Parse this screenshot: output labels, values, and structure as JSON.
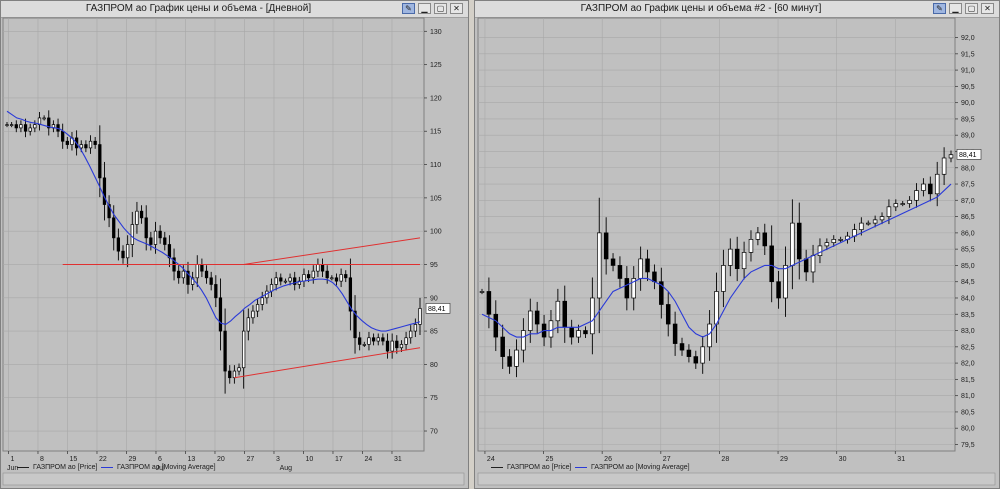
{
  "windows": [
    {
      "title": "ГАЗПРОМ ао График цены и объема - [Дневной]",
      "legend": [
        "ГАЗПРОМ ао [Price]",
        "ГАЗПРОМ ао [Moving Average]"
      ]
    },
    {
      "title": "ГАЗПРОМ ао График цены и объема #2 - [60 минут]",
      "legend": [
        "ГАЗПРОМ ао [Price]",
        "ГАЗПРОМ ао [Moving Average]"
      ]
    }
  ],
  "colors": {
    "plot_bg": "#c0c0c0",
    "grid": "#a8a8a8",
    "candle": "#000000",
    "moving_average": "#2a3ad8",
    "trend_line": "#e03030"
  },
  "icons": [
    "pin-icon",
    "minimize-icon",
    "maximize-icon",
    "close-icon"
  ],
  "chart_data": [
    {
      "type": "candlestick",
      "ylim": [
        67,
        132
      ],
      "y_ticks": [
        70,
        75,
        80,
        85,
        90,
        95,
        100,
        105,
        110,
        115,
        120,
        125,
        130
      ],
      "x_ticks": [
        "1",
        "8",
        "15",
        "22",
        "29",
        "6",
        "13",
        "20",
        "27",
        "3",
        "10",
        "17",
        "24",
        "31"
      ],
      "months": [
        "Jun",
        "Jul",
        "Aug"
      ],
      "last_price_label": "88,41",
      "close": [
        116,
        116,
        115.5,
        116,
        115,
        115.5,
        116,
        117,
        117,
        115.5,
        116,
        115,
        113.5,
        113,
        114,
        112.5,
        113,
        112.5,
        113.5,
        113,
        108,
        104,
        102,
        99,
        97,
        96,
        98,
        101,
        103,
        102,
        99,
        98,
        100,
        99,
        98,
        96,
        94,
        93,
        94,
        92,
        93,
        95,
        94,
        93,
        92,
        90,
        85,
        79,
        78,
        79,
        79.5,
        85,
        87,
        88,
        89,
        90,
        91,
        92,
        93,
        92.5,
        92.5,
        93,
        92,
        92.5,
        93.5,
        93,
        94,
        95,
        94,
        93,
        93,
        92.5,
        93.5,
        93,
        88,
        84,
        83,
        83,
        84,
        83.5,
        84,
        83.5,
        82,
        83.5,
        82.5,
        83,
        84,
        85,
        86,
        88.4
      ],
      "series": [
        {
          "name": "ГАЗПРОМ ао [Moving Average]",
          "values": [
            118,
            117.5,
            117,
            116.8,
            116.5,
            116.3,
            116.2,
            116,
            115.8,
            115.6,
            115.5,
            115.3,
            114.8,
            114.2,
            113.5,
            112.5,
            111.2,
            109.8,
            108.3,
            106.8,
            105.2,
            103.8,
            102.5,
            101.5,
            100.5,
            99.7,
            99,
            98.6,
            98.3,
            98,
            97.6,
            97.2,
            96.8,
            96.3,
            95.8,
            95.2,
            94.6,
            93.8,
            93,
            92.2,
            91.2,
            90,
            88.5,
            87,
            86.2,
            86,
            86.5,
            87.2,
            87.8,
            88.5,
            89,
            89.6,
            90,
            90.4,
            90.8,
            91.2,
            91.5,
            91.8,
            92,
            92.2,
            92.4,
            92.5,
            92.6,
            92.7,
            92.8,
            92.8,
            92.7,
            92.3,
            91.6,
            90.6,
            89.4,
            88.2,
            87.3,
            86.6,
            86,
            85.5,
            85.2,
            85,
            85,
            85.2,
            85.4,
            85.6,
            85.8,
            86,
            86.2,
            86.4
          ]
        }
      ],
      "trend_lines": [
        {
          "from": [
            12,
            95
          ],
          "to": [
            89,
            95
          ]
        },
        {
          "from": [
            51,
            95
          ],
          "to": [
            89,
            99
          ]
        },
        {
          "from": [
            49,
            78
          ],
          "to": [
            89,
            82.5
          ]
        }
      ]
    },
    {
      "type": "candlestick",
      "ylim": [
        79.3,
        92.6
      ],
      "y_ticks": [
        "92,0",
        "91,5",
        "91,0",
        "90,5",
        "90,0",
        "89,5",
        "89,0",
        "88,5",
        "88,0",
        "87,5",
        "87,0",
        "86,5",
        "86,0",
        "85,5",
        "85,0",
        "84,5",
        "84,0",
        "83,5",
        "83,0",
        "82,5",
        "82,0",
        "81,5",
        "81,0",
        "80,5",
        "80,0",
        "79,5"
      ],
      "x_ticks": [
        "24",
        "25",
        "26",
        "27",
        "28",
        "29",
        "30",
        "31"
      ],
      "last_price_label": "88,41",
      "close": [
        84.2,
        83.5,
        82.8,
        82.2,
        81.9,
        82.4,
        83.0,
        83.6,
        83.2,
        82.8,
        83.3,
        83.9,
        83.1,
        82.8,
        83.0,
        82.9,
        84.0,
        86.0,
        85.2,
        85.0,
        84.6,
        84.0,
        84.6,
        85.2,
        84.8,
        84.5,
        83.8,
        83.2,
        82.6,
        82.4,
        82.2,
        82.0,
        82.5,
        83.2,
        84.2,
        85.0,
        85.5,
        84.9,
        85.4,
        85.8,
        86.0,
        85.6,
        84.5,
        84.0,
        85.0,
        86.3,
        85.2,
        84.8,
        85.3,
        85.6,
        85.7,
        85.8,
        85.8,
        85.9,
        86.1,
        86.3,
        86.3,
        86.4,
        86.5,
        86.8,
        86.9,
        86.9,
        87.0,
        87.3,
        87.5,
        87.2,
        87.8,
        88.3,
        88.4
      ],
      "series": [
        {
          "name": "ГАЗПРОМ ао [Moving Average]",
          "values": [
            83.5,
            83.4,
            83.3,
            83.1,
            82.9,
            82.8,
            82.8,
            82.9,
            82.9,
            83.0,
            83.0,
            83.1,
            83.1,
            83.1,
            83.1,
            83.2,
            83.3,
            83.6,
            83.9,
            84.2,
            84.3,
            84.4,
            84.5,
            84.6,
            84.6,
            84.5,
            84.4,
            84.2,
            83.9,
            83.5,
            83.1,
            82.9,
            82.8,
            82.9,
            83.2,
            83.6,
            84.0,
            84.3,
            84.6,
            84.8,
            84.9,
            85.0,
            85.0,
            84.9,
            84.9,
            85.0,
            85.1,
            85.2,
            85.3,
            85.4,
            85.5,
            85.6,
            85.7,
            85.8,
            85.9,
            86.0,
            86.1,
            86.2,
            86.3,
            86.4,
            86.5,
            86.6,
            86.7,
            86.8,
            86.9,
            87.0,
            87.1,
            87.3,
            87.5
          ]
        }
      ]
    }
  ]
}
